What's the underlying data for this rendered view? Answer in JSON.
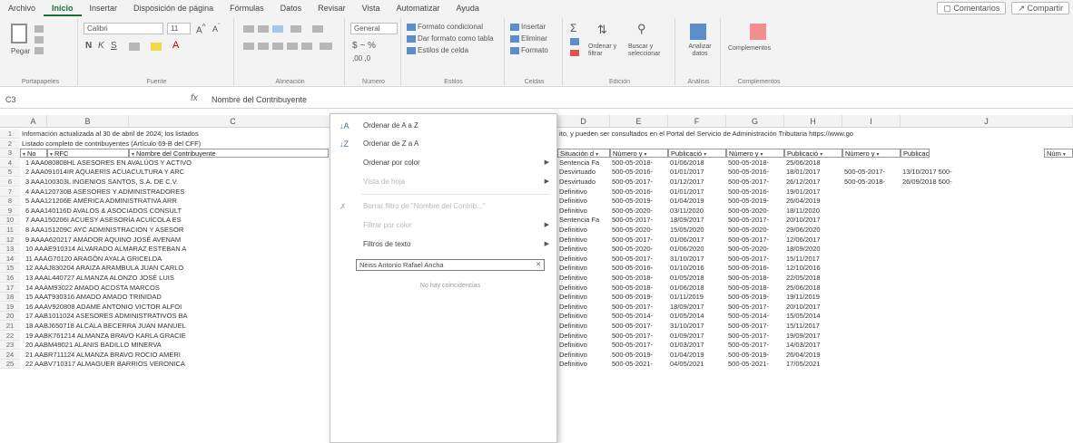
{
  "menu": {
    "tabs": [
      "Archivo",
      "Inicio",
      "Insertar",
      "Disposición de página",
      "Fórmulas",
      "Datos",
      "Revisar",
      "Vista",
      "Automatizar",
      "Ayuda"
    ],
    "comments_label": "Comentarios",
    "share_label": "Compartir"
  },
  "ribbon": {
    "paste_label": "Pegar",
    "font_name": "Calibri",
    "font_size": "11",
    "number_format": "General",
    "styles": [
      "Formato condicional",
      "Dar formato como tabla",
      "Estilos de celda"
    ],
    "cells": [
      "Insertar",
      "Eliminar",
      "Formato"
    ],
    "sort_label": "Ordenar y filtrar",
    "find_label": "Buscar y seleccionar",
    "analyze_label": "Analizar datos",
    "addins_label": "Complementos",
    "groups": [
      "Portapapeles",
      "Fuente",
      "Alineación",
      "Número",
      "Estilos",
      "Celdas",
      "Edición",
      "Análisis",
      "Complementos"
    ]
  },
  "formula_bar": {
    "name_box": "C3",
    "fx": "fx",
    "value": "Nombre del Contribuyente"
  },
  "grid": {
    "columns": [
      "A",
      "B",
      "C",
      "D",
      "E",
      "F",
      "G",
      "H",
      "I",
      "J"
    ],
    "row1_text": "Información actualizada al 30 de abril de 2024; los listados",
    "row1_text_right": "ito, y pueden ser consultados en el Portal del Servicio de Administración Tributaria https://www.go",
    "row2_text": "Listado completo de contribuyentes (Artículo 69-B del CFF)",
    "headers_left": [
      "No",
      "RFC",
      "Nombre del Contribuyente"
    ],
    "headers_right": [
      "Situación d",
      "Número y",
      "Publicació",
      "Número y",
      "Publicació",
      "Número y",
      "Publicació",
      "Núm"
    ],
    "row_numbers": [
      "1",
      "2",
      "3",
      "4",
      "5",
      "6",
      "7",
      "8",
      "9",
      "10",
      "11",
      "12",
      "13",
      "14",
      "15",
      "16",
      "17",
      "18",
      "19",
      "20",
      "21",
      "22",
      "23",
      "24",
      "25"
    ],
    "left_rows": [
      "1 AAA080808HL ASESORES EN AVALÚOS Y ACTIVO",
      "2 AAA091014IR AQUAERIS ACUACULTURA Y ARC",
      "3 AAA100303L INGENIOS SANTOS, S.A. DE C.V.",
      "4 AAA120730B ASESORES Y ADMINISTRADORES",
      "5 AAA121206E AMÉRICA ADMINISTRATIVA ARR",
      "6 AAA140116D AVALOS & ASOCIADOS CONSULT",
      "7 AAA150206I ACUESY ASESORÍA ACUÍCOLA ES",
      "8 AAA151209C AYC ADMINISTRACION Y ASESOR",
      "9 AAAA620217 AMADOR AQUINO JOSÉ AVENAM",
      "10 AAAE910314 ALVARADO ALMARAZ ESTEBAN A",
      "11 AAAG70120 ARAGÓN AYALA GRICELDA",
      "12 AAAJ830204 ARAIZA ARAMBULA JUAN CARLO",
      "13 AAAL440727 ALMANZA ALONZO JOSÉ LUIS",
      "14 AAAM93022 AMADO ACOSTA MARCOS",
      "15 AAAT930316 AMADO AMADO TRINIDAD",
      "16 AAAV920808 ADAME ANTONIO VICTOR ALFOI",
      "17 AAB1011024 ASESORES ADMINISTRATIVOS BA",
      "18 AABJ650718 ALCALA BECERRA JUAN MANUEL",
      "19 AABK761214 ALMANZA BRAVO KARLA GRACIE",
      "20 AABM49021 ALANIS BADILLO MINERVA",
      "21 AABR711124 ALMANZA BRAVO ROCIO AMERI",
      "22 AABV710317 ALMAGUER BARRIOS VERONICA"
    ],
    "right_rows": [
      [
        "Sentencia Fa",
        "500-05-2018-",
        "01/06/2018",
        "500-05-2018-",
        "25/06/2018",
        "",
        ""
      ],
      [
        "Desvirtuado",
        "500-05-2016-",
        "01/01/2017",
        "500-05-2016-",
        "18/01/2017",
        "500-05-2017-",
        "13/10/2017 500-"
      ],
      [
        "Desvirtuado",
        "500-05-2017-",
        "01/12/2017",
        "500-05-2017-",
        "26/12/2017",
        "500-05-2018-",
        "26/09/2018 500-"
      ],
      [
        "Definitivo",
        "500-05-2016-",
        "01/01/2017",
        "500-05-2016-",
        "19/01/2017",
        "",
        ""
      ],
      [
        "Definitivo",
        "500-05-2019-",
        "01/04/2019",
        "500-05-2019-",
        "26/04/2019",
        "",
        ""
      ],
      [
        "Definitivo",
        "500-05-2020-",
        "03/11/2020",
        "500-05-2020-",
        "18/11/2020",
        "",
        ""
      ],
      [
        "Sentencia Fa",
        "500-05-2017-",
        "18/09/2017",
        "500-05-2017-",
        "20/10/2017",
        "",
        ""
      ],
      [
        "Definitivo",
        "500-05-2020-",
        "15/05/2020",
        "500-05-2020-",
        "29/06/2020",
        "",
        ""
      ],
      [
        "Definitivo",
        "500-05-2017-",
        "01/06/2017",
        "500-05-2017-",
        "12/06/2017",
        "",
        ""
      ],
      [
        "Definitivo",
        "500-05-2020-",
        "01/06/2020",
        "500-05-2020-",
        "18/09/2020",
        "",
        ""
      ],
      [
        "Definitivo",
        "500-05-2017-",
        "31/10/2017",
        "500-05-2017-",
        "15/11/2017",
        "",
        ""
      ],
      [
        "Definitivo",
        "500-05-2016-",
        "01/10/2016",
        "500-05-2016-",
        "12/10/2016",
        "",
        ""
      ],
      [
        "Definitivo",
        "500-05-2018-",
        "01/05/2018",
        "500-05-2018-",
        "22/05/2018",
        "",
        ""
      ],
      [
        "Definitivo",
        "500-05-2018-",
        "01/06/2018",
        "500-05-2018-",
        "25/06/2018",
        "",
        ""
      ],
      [
        "Definitivo",
        "500-05-2019-",
        "01/11/2019",
        "500-05-2019-",
        "19/11/2019",
        "",
        ""
      ],
      [
        "Definitivo",
        "500-05-2017-",
        "18/09/2017",
        "500-05-2017-",
        "20/10/2017",
        "",
        ""
      ],
      [
        "Definitivo",
        "500-05-2014-",
        "01/05/2014",
        "500-05-2014-",
        "15/05/2014",
        "",
        ""
      ],
      [
        "Definitivo",
        "500-05-2017-",
        "31/10/2017",
        "500-05-2017-",
        "15/11/2017",
        "",
        ""
      ],
      [
        "Definitivo",
        "500-05-2017-",
        "01/09/2017",
        "500-05-2017-",
        "19/09/2017",
        "",
        ""
      ],
      [
        "Definitivo",
        "500-05-2017-",
        "01/03/2017",
        "500-05-2017-",
        "14/03/2017",
        "",
        ""
      ],
      [
        "Definitivo",
        "500-05-2019-",
        "01/04/2019",
        "500-05-2019-",
        "26/04/2019",
        "",
        ""
      ],
      [
        "Definitivo",
        "500-05-2021-",
        "04/05/2021",
        "500-05-2021-",
        "17/05/2021",
        "",
        ""
      ]
    ]
  },
  "dropdown": {
    "sort_az": "Ordenar de A a Z",
    "sort_za": "Ordenar de Z a A",
    "sort_color": "Ordenar por color",
    "sheet_view": "Vista de hoja",
    "clear_filter": "Borrar filtro de \"Nombre del Contrib...\"",
    "filter_color": "Filtrar por color",
    "text_filters": "Filtros de texto",
    "search_value": "Neiss Antonio Rafael Ancha",
    "no_matches": "No hay coincidencias"
  }
}
